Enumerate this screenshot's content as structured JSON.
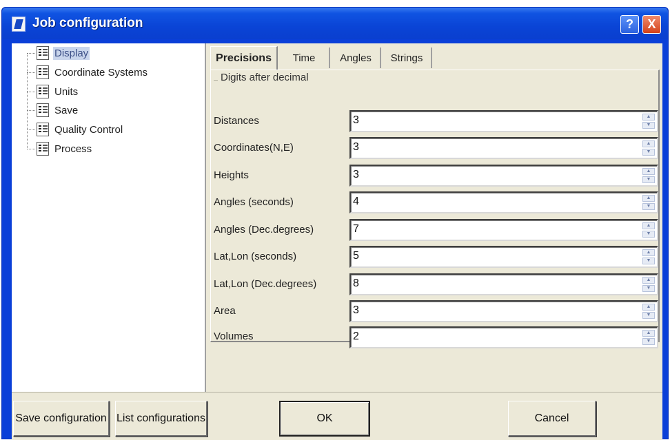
{
  "window": {
    "title": "Job configuration",
    "help_label": "?",
    "close_label": "X"
  },
  "tree": {
    "items": [
      {
        "label": "Display",
        "selected": true
      },
      {
        "label": "Coordinate Systems",
        "selected": false
      },
      {
        "label": "Units",
        "selected": false
      },
      {
        "label": "Save",
        "selected": false
      },
      {
        "label": "Quality Control",
        "selected": false
      },
      {
        "label": "Process",
        "selected": false
      }
    ]
  },
  "tabs": [
    {
      "label": "Precisions",
      "active": true
    },
    {
      "label": "Time",
      "active": false
    },
    {
      "label": "Angles",
      "active": false
    },
    {
      "label": "Strings",
      "active": false
    }
  ],
  "precisions": {
    "group_title": "Digits after decimal",
    "rows": [
      {
        "label": "Distances",
        "value": "3"
      },
      {
        "label": "Coordinates(N,E)",
        "value": "3"
      },
      {
        "label": "Heights",
        "value": "3"
      },
      {
        "label": "Angles (seconds)",
        "value": "4"
      },
      {
        "label": "Angles (Dec.degrees)",
        "value": "7"
      },
      {
        "label": "Lat,Lon (seconds)",
        "value": "5"
      },
      {
        "label": "Lat,Lon (Dec.degrees)",
        "value": "8"
      },
      {
        "label": "Area",
        "value": "3"
      },
      {
        "label": "Volumes",
        "value": "2"
      }
    ]
  },
  "buttons": {
    "save_configuration": "Save configuration",
    "list_configurations": "List configurations",
    "ok": "OK",
    "cancel": "Cancel"
  },
  "colors": {
    "titlebar": "#0a44d6",
    "face": "#ece9d8",
    "selection": "#c9d5ec"
  }
}
